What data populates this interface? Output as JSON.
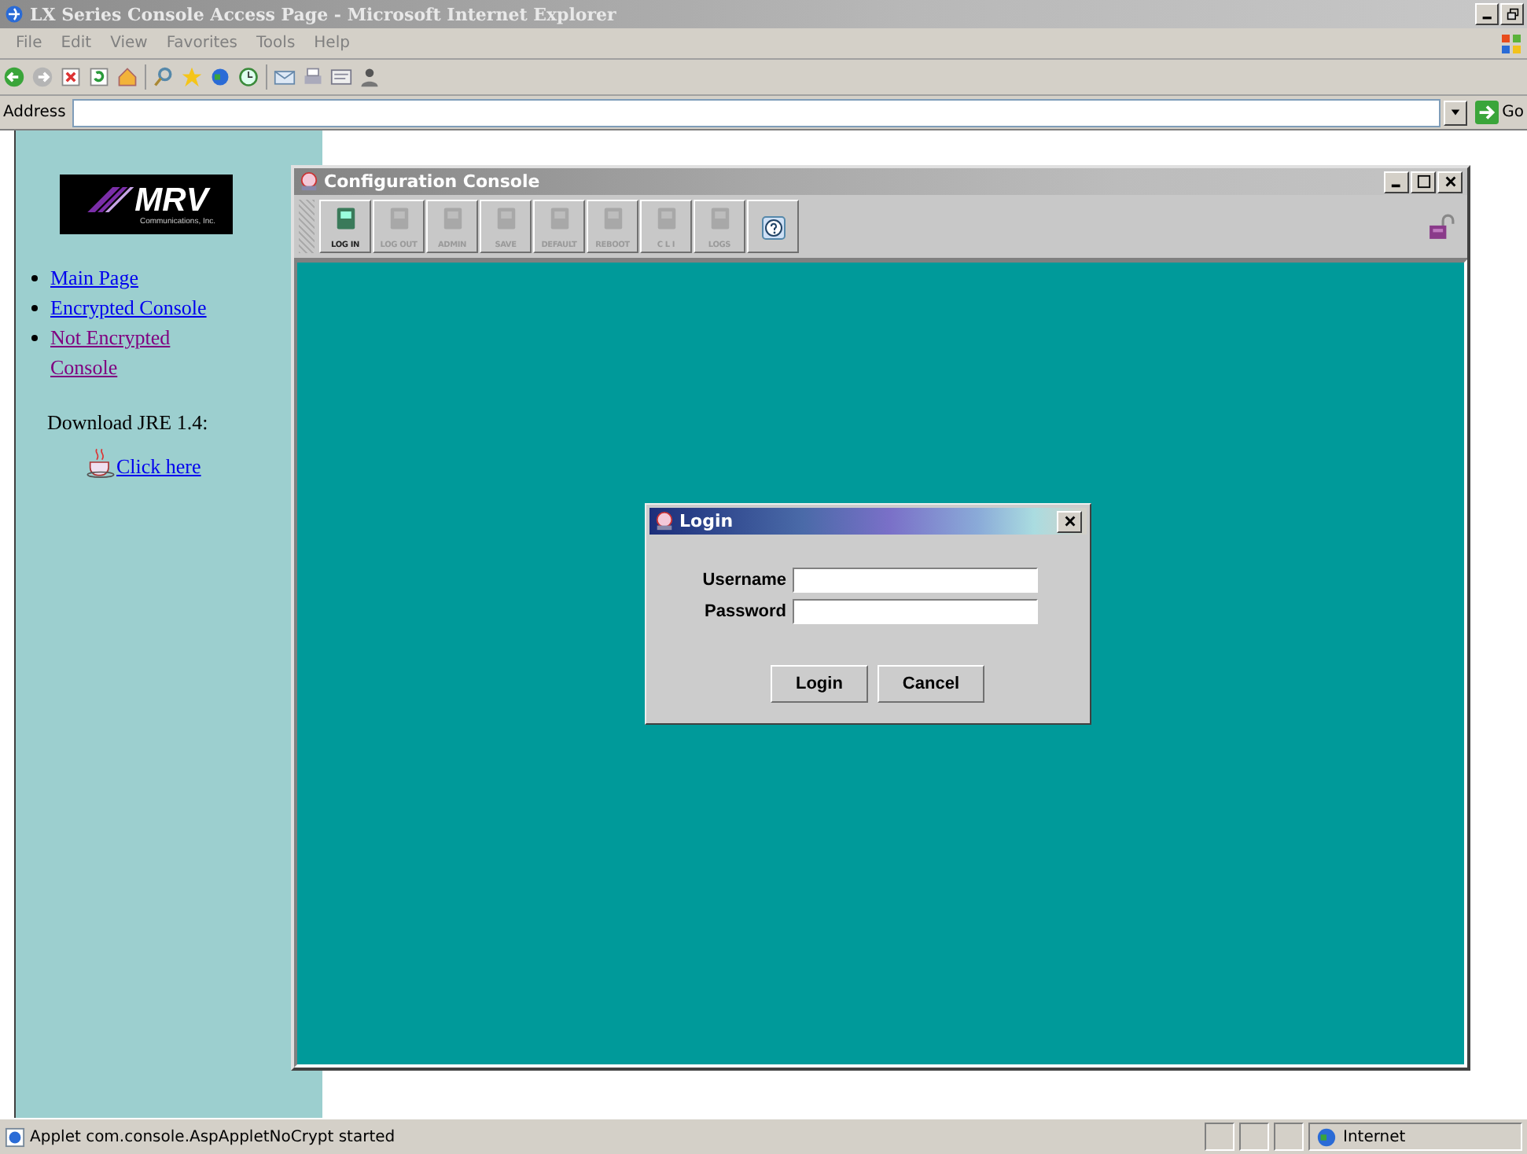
{
  "window": {
    "title": "LX Series Console Access Page - Microsoft Internet Explorer"
  },
  "menu": [
    "File",
    "Edit",
    "View",
    "Favorites",
    "Tools",
    "Help"
  ],
  "address": {
    "label": "Address",
    "go": "Go"
  },
  "sidebar": {
    "logo": {
      "name": "MRV",
      "tagline": "Communications, Inc."
    },
    "links": [
      {
        "text": "Main Page",
        "visited": false
      },
      {
        "text": "Encrypted Console",
        "visited": false
      },
      {
        "text": "Not Encrypted Console",
        "visited": true
      }
    ],
    "download_label": "Download JRE 1.4:",
    "download_link": "Click here"
  },
  "applet": {
    "title": "Configuration Console",
    "tools": [
      {
        "label": "LOG IN",
        "disabled": false
      },
      {
        "label": "LOG OUT",
        "disabled": true
      },
      {
        "label": "ADMIN",
        "disabled": true
      },
      {
        "label": "SAVE",
        "disabled": true
      },
      {
        "label": "DEFAULT",
        "disabled": true
      },
      {
        "label": "REBOOT",
        "disabled": true
      },
      {
        "label": "C L I",
        "disabled": true
      },
      {
        "label": "LOGS",
        "disabled": true
      }
    ]
  },
  "dialog": {
    "title": "Login",
    "fields": [
      {
        "label": "Username"
      },
      {
        "label": "Password"
      }
    ],
    "buttons": [
      "Login",
      "Cancel"
    ]
  },
  "status_bar": {
    "message": "Applet com.console.AspAppletNoCrypt started",
    "zone": "Internet"
  }
}
